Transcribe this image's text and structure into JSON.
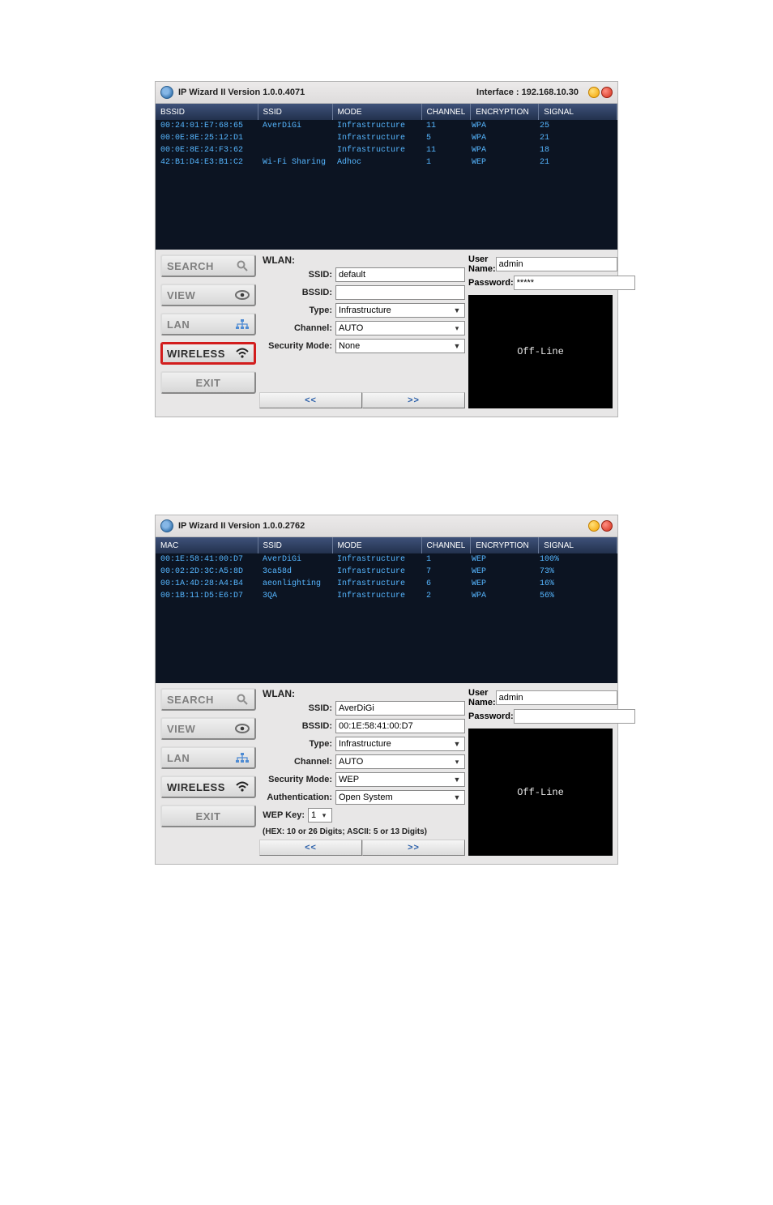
{
  "windows": [
    {
      "title_app": "IP Wizard II  Version 1.0.0.4071",
      "title_interface": "Interface :  192.168.10.30",
      "table": {
        "headers": [
          "BSSID",
          "SSID",
          "MODE",
          "CHANNEL",
          "ENCRYPTION",
          "SIGNAL"
        ],
        "rows": [
          {
            "c0": "00:24:01:E7:68:65",
            "c1": "AverDiGi",
            "c2": "Infrastructure",
            "c3": "11",
            "c4": "WPA",
            "c5": "25"
          },
          {
            "c0": "00:0E:8E:25:12:D1",
            "c1": "",
            "c2": "Infrastructure",
            "c3": "5",
            "c4": "WPA",
            "c5": "21"
          },
          {
            "c0": "00:0E:8E:24:F3:62",
            "c1": "",
            "c2": "Infrastructure",
            "c3": "11",
            "c4": "WPA",
            "c5": "18"
          },
          {
            "c0": "42:B1:D4:E3:B1:C2",
            "c1": "Wi-Fi Sharing",
            "c2": "Adhoc",
            "c3": "1",
            "c4": "WEP",
            "c5": "21"
          }
        ]
      },
      "nav": {
        "search": "SEARCH",
        "view": "VIEW",
        "lan": "LAN",
        "wireless": "WIRELESS",
        "exit": "EXIT",
        "active": "wireless"
      },
      "wlan": {
        "heading": "WLAN:",
        "labels": {
          "ssid": "SSID:",
          "bssid": "BSSID:",
          "type": "Type:",
          "channel": "Channel:",
          "secmode": "Security Mode:"
        },
        "values": {
          "ssid": "default",
          "bssid": "",
          "type": "Infrastructure",
          "channel": "AUTO",
          "secmode": "None"
        }
      },
      "creds": {
        "user_label": "User Name:",
        "pass_label": "Password:",
        "user": "admin",
        "pass": "*****"
      },
      "status": "Off-Line",
      "pager": {
        "prev": "<<",
        "next": ">>"
      }
    },
    {
      "title_app": "IP Wizard II  Version 1.0.0.2762",
      "title_interface": "",
      "table": {
        "headers": [
          "MAC",
          "SSID",
          "MODE",
          "CHANNEL",
          "ENCRYPTION",
          "SIGNAL"
        ],
        "rows": [
          {
            "c0": "00:1E:58:41:00:D7",
            "c1": "AverDiGi",
            "c2": "Infrastructure",
            "c3": "1",
            "c4": "WEP",
            "c5": "100%"
          },
          {
            "c0": "00:02:2D:3C:A5:8D",
            "c1": "3ca58d",
            "c2": "Infrastructure",
            "c3": "7",
            "c4": "WEP",
            "c5": "73%"
          },
          {
            "c0": "00:1A:4D:28:A4:B4",
            "c1": "aeonlighting",
            "c2": "Infrastructure",
            "c3": "6",
            "c4": "WEP",
            "c5": "16%"
          },
          {
            "c0": "00:1B:11:D5:E6:D7",
            "c1": "3QA",
            "c2": "Infrastructure",
            "c3": "2",
            "c4": "WPA",
            "c5": "56%"
          }
        ]
      },
      "nav": {
        "search": "SEARCH",
        "view": "VIEW",
        "lan": "LAN",
        "wireless": "WIRELESS",
        "exit": "EXIT",
        "active": "wireless"
      },
      "wlan": {
        "heading": "WLAN:",
        "labels": {
          "ssid": "SSID:",
          "bssid": "BSSID:",
          "type": "Type:",
          "channel": "Channel:",
          "secmode": "Security Mode:",
          "auth": "Authentication:",
          "wepkey": "WEP Key:"
        },
        "values": {
          "ssid": "AverDiGi",
          "bssid": "00:1E:58:41:00:D7",
          "type": "Infrastructure",
          "channel": "AUTO",
          "secmode": "WEP",
          "auth": "Open System",
          "wepkey": "1"
        },
        "hint": "(HEX: 10 or 26 Digits; ASCII: 5 or 13 Digits)"
      },
      "creds": {
        "user_label": "User Name:",
        "pass_label": "Password:",
        "user": "admin",
        "pass": ""
      },
      "status": "Off-Line",
      "pager": {
        "prev": "<<",
        "next": ">>"
      }
    }
  ]
}
